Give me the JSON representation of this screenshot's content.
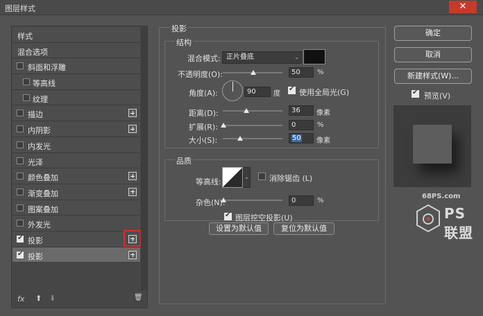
{
  "window": {
    "title": "图层样式",
    "close_glyph": "✕"
  },
  "left_panel": {
    "items": [
      {
        "label": "样式",
        "checkbox": false,
        "has_checkbox": false,
        "plus": false
      },
      {
        "label": "混合选项",
        "checkbox": false,
        "has_checkbox": false,
        "plus": false
      },
      {
        "label": "斜面和浮雕",
        "checkbox": false,
        "has_checkbox": true,
        "plus": false
      },
      {
        "label": "等高线",
        "checkbox": false,
        "has_checkbox": true,
        "plus": false,
        "sub": true
      },
      {
        "label": "纹理",
        "checkbox": false,
        "has_checkbox": true,
        "plus": false,
        "sub": true
      },
      {
        "label": "描边",
        "checkbox": false,
        "has_checkbox": true,
        "plus": true
      },
      {
        "label": "内阴影",
        "checkbox": false,
        "has_checkbox": true,
        "plus": true
      },
      {
        "label": "内发光",
        "checkbox": false,
        "has_checkbox": true,
        "plus": false
      },
      {
        "label": "光泽",
        "checkbox": false,
        "has_checkbox": true,
        "plus": false
      },
      {
        "label": "颜色叠加",
        "checkbox": false,
        "has_checkbox": true,
        "plus": true
      },
      {
        "label": "渐变叠加",
        "checkbox": false,
        "has_checkbox": true,
        "plus": true
      },
      {
        "label": "图案叠加",
        "checkbox": false,
        "has_checkbox": true,
        "plus": false
      },
      {
        "label": "外发光",
        "checkbox": false,
        "has_checkbox": true,
        "plus": false
      },
      {
        "label": "投影",
        "checkbox": true,
        "has_checkbox": true,
        "plus": true,
        "highlight_plus": true
      },
      {
        "label": "投影",
        "checkbox": true,
        "has_checkbox": true,
        "plus": true,
        "selected": true
      }
    ],
    "footer": {
      "fx": "fx",
      "up": "⬆",
      "down": "⬇",
      "trash": "🗑"
    }
  },
  "drop_shadow": {
    "section_title": "投影",
    "structure": {
      "title": "结构",
      "blend_mode_label": "混合模式:",
      "blend_mode_value": "正片叠底",
      "blend_color": "#111111",
      "opacity_label": "不透明度(O):",
      "opacity_value": "50",
      "opacity_unit": "%",
      "angle_label": "角度(A):",
      "angle_value": "90",
      "angle_unit": "度",
      "global_light_label": "使用全局光(G)",
      "global_light_checked": true,
      "distance_label": "距离(D):",
      "distance_value": "36",
      "distance_unit": "像素",
      "spread_label": "扩展(R):",
      "spread_value": "0",
      "spread_unit": "%",
      "size_label": "大小(S):",
      "size_value": "50",
      "size_unit": "像素"
    },
    "quality": {
      "title": "品质",
      "contour_label": "等高线:",
      "antialias_label": "消除锯齿 (L)",
      "antialias_checked": false,
      "noise_label": "杂色(N):",
      "noise_value": "0",
      "noise_unit": "%"
    },
    "knockout_label": "图层挖空投影(U)",
    "knockout_checked": true,
    "set_default_label": "设置为默认值",
    "reset_default_label": "复位为默认值"
  },
  "right_panel": {
    "ok_label": "确定",
    "cancel_label": "取消",
    "new_style_label": "新建样式(W)...",
    "preview_label": "预览(V)",
    "preview_checked": true
  },
  "watermark": {
    "url": "68PS.com",
    "brand": "PS联盟"
  }
}
